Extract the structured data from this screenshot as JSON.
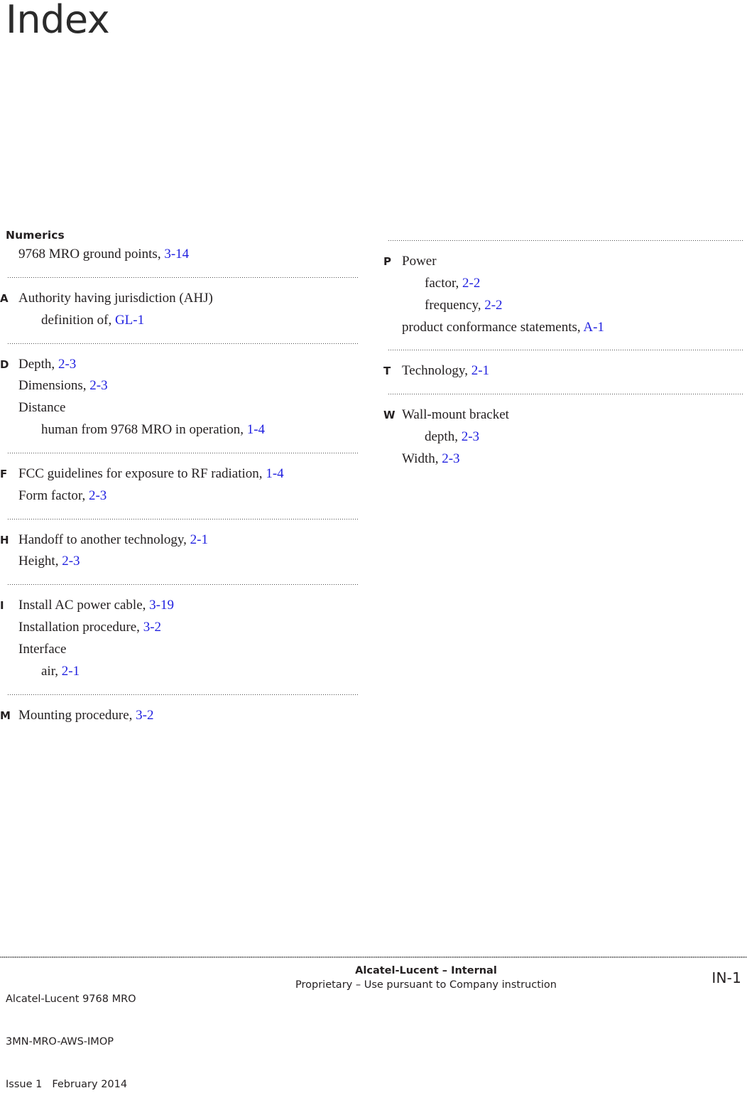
{
  "document": {
    "title": "Index"
  },
  "link_color": "#2020e0",
  "index": {
    "left_column": [
      {
        "heading": "Numerics",
        "letter": "",
        "entries": [
          {
            "level": 1,
            "text": "9768 MRO ground points, ",
            "ref": "3-14"
          }
        ],
        "separator_after": true
      },
      {
        "heading": "",
        "letter": "A",
        "entries": [
          {
            "level": 1,
            "text": "Authority having jurisdiction (AHJ)",
            "ref": ""
          },
          {
            "level": 2,
            "text": "definition of, ",
            "ref": "GL-1"
          }
        ],
        "separator_after": true
      },
      {
        "heading": "",
        "letter": "D",
        "entries": [
          {
            "level": 1,
            "text": "Depth, ",
            "ref": "2-3"
          },
          {
            "level": 1,
            "text": "Dimensions, ",
            "ref": "2-3"
          },
          {
            "level": 1,
            "text": "Distance",
            "ref": ""
          },
          {
            "level": 2,
            "text": "human from 9768 MRO in operation, ",
            "ref": "1-4"
          }
        ],
        "separator_after": true
      },
      {
        "heading": "",
        "letter": "F",
        "entries": [
          {
            "level": 1,
            "text": "FCC guidelines for exposure to RF radiation, ",
            "ref": "1-4"
          },
          {
            "level": 1,
            "text": "Form factor, ",
            "ref": "2-3"
          }
        ],
        "separator_after": true
      },
      {
        "heading": "",
        "letter": "H",
        "entries": [
          {
            "level": 1,
            "text": "Handoff to another technology, ",
            "ref": "2-1"
          },
          {
            "level": 1,
            "text": "Height, ",
            "ref": "2-3"
          }
        ],
        "separator_after": true
      },
      {
        "heading": "",
        "letter": "I",
        "entries": [
          {
            "level": 1,
            "text": "Install AC power cable, ",
            "ref": "3-19"
          },
          {
            "level": 1,
            "text": "Installation procedure, ",
            "ref": "3-2"
          },
          {
            "level": 1,
            "text": "Interface",
            "ref": ""
          },
          {
            "level": 2,
            "text": "air, ",
            "ref": "2-1"
          }
        ],
        "separator_after": true
      },
      {
        "heading": "",
        "letter": "M",
        "entries": [
          {
            "level": 1,
            "text": "Mounting procedure, ",
            "ref": "3-2"
          }
        ],
        "separator_after": false
      }
    ],
    "right_column": [
      {
        "heading": "",
        "letter": "P",
        "separator_before": true,
        "entries": [
          {
            "level": 1,
            "text": "Power",
            "ref": ""
          },
          {
            "level": 2,
            "text": "factor, ",
            "ref": "2-2"
          },
          {
            "level": 2,
            "text": "frequency, ",
            "ref": "2-2"
          },
          {
            "level": 1,
            "text": "product conformance statements, ",
            "ref": "A-1"
          }
        ],
        "separator_after": true
      },
      {
        "heading": "",
        "letter": "T",
        "separator_before": false,
        "entries": [
          {
            "level": 1,
            "text": "Technology, ",
            "ref": "2-1"
          }
        ],
        "separator_after": true
      },
      {
        "heading": "",
        "letter": "W",
        "separator_before": false,
        "entries": [
          {
            "level": 1,
            "text": "Wall-mount bracket",
            "ref": ""
          },
          {
            "level": 2,
            "text": "depth, ",
            "ref": "2-3"
          },
          {
            "level": 1,
            "text": "Width, ",
            "ref": "2-3"
          }
        ],
        "separator_after": false
      }
    ]
  },
  "footer": {
    "product": "Alcatel-Lucent 9768 MRO",
    "doc_number": "3MN-MRO-AWS-IMOP",
    "issue": "Issue 1",
    "date": "February 2014",
    "classification": "Alcatel-Lucent – Internal",
    "proprietary": "Proprietary – Use pursuant to Company instruction",
    "page_number": "IN-1"
  }
}
